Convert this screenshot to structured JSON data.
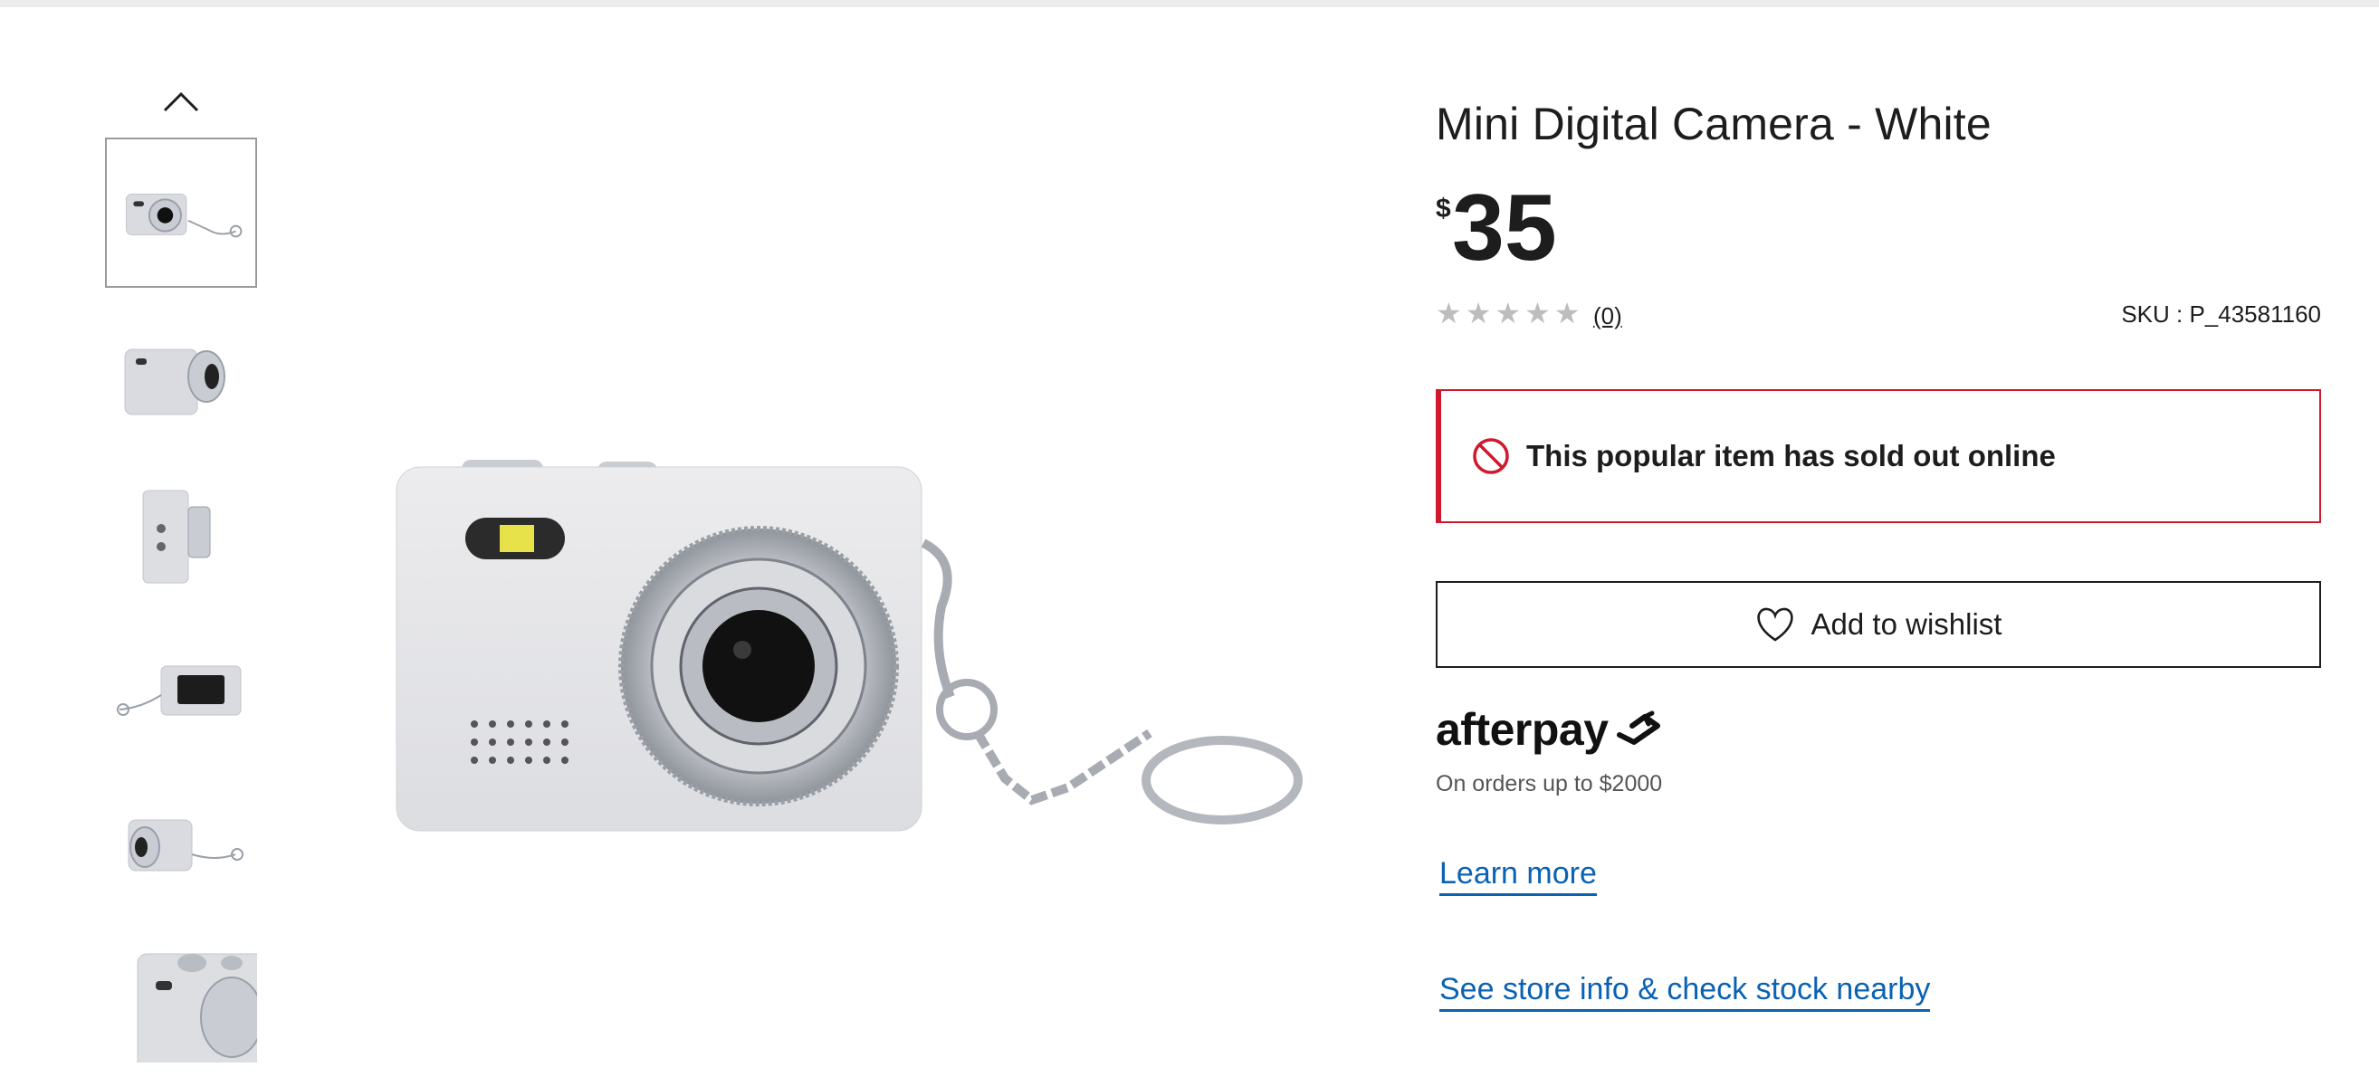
{
  "product": {
    "title": "Mini Digital Camera - White",
    "price_currency": "$",
    "price_amount": "35",
    "rating": 0,
    "rating_max": 5,
    "review_count": "(0)",
    "sku": "SKU : P_43581160"
  },
  "alert": {
    "icon": "prohibited-icon",
    "text": "This popular item has sold out online",
    "color": "#d0192c"
  },
  "wishlist": {
    "icon": "heart-icon",
    "label": "Add to wishlist"
  },
  "afterpay": {
    "logo_text": "afterpay",
    "note": "On orders up to $2000",
    "learn_more": "Learn more"
  },
  "store_link": "See store info & check stock nearby",
  "gallery": {
    "up_icon": "chevron-up-icon",
    "thumbnails": [
      {
        "view": "front"
      },
      {
        "view": "angled-right"
      },
      {
        "view": "side"
      },
      {
        "view": "back"
      },
      {
        "view": "angled-left"
      },
      {
        "view": "top-angled"
      }
    ],
    "active_index": 0
  },
  "colors": {
    "link": "#0a62b3",
    "alert_border": "#d0192c",
    "text": "#1d1d1d"
  }
}
